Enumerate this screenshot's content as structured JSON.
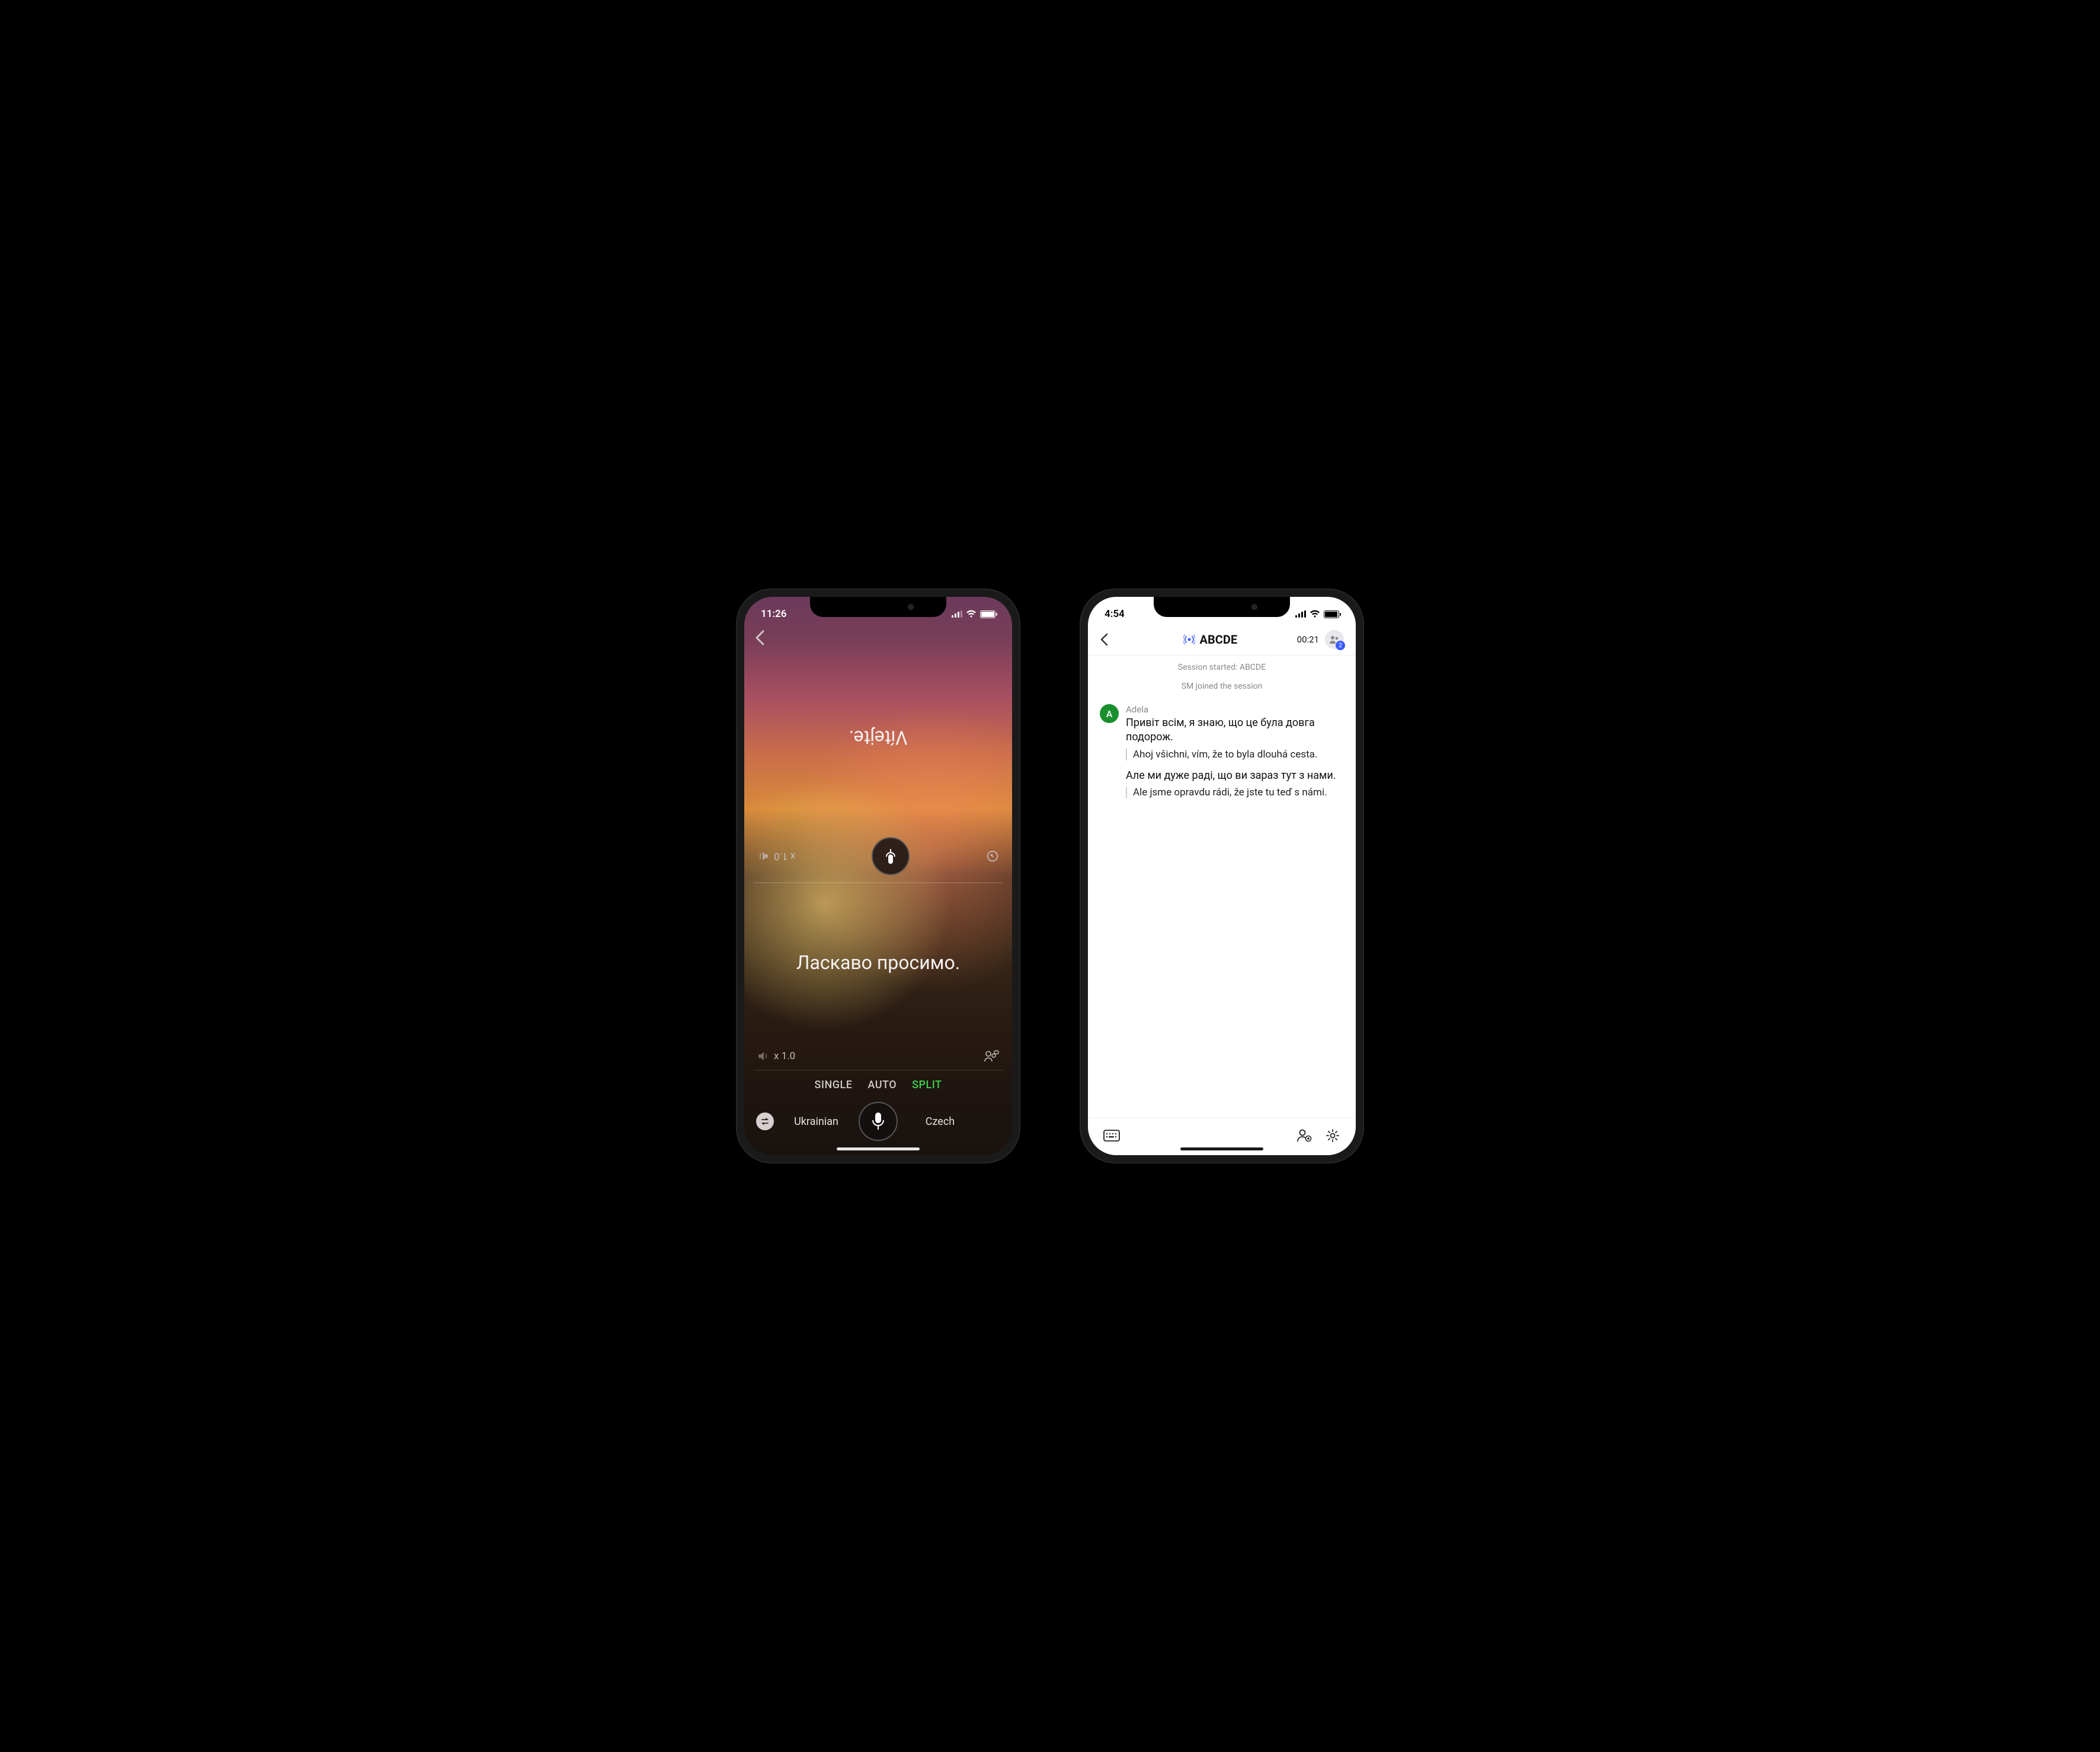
{
  "phone1": {
    "status": {
      "time": "11:26",
      "battery_pct": 95
    },
    "top": {
      "speed": "x 1.0",
      "translation": "Vítejte."
    },
    "bottom": {
      "speed": "x 1.0",
      "translation": "Ласкаво просимо."
    },
    "modes": {
      "single": "SINGLE",
      "auto": "AUTO",
      "split": "SPLIT"
    },
    "lang1": "Ukrainian",
    "lang2": "Czech"
  },
  "phone2": {
    "status": {
      "time": "4:54",
      "battery_pct": 90
    },
    "header": {
      "session_id": "ABCDE",
      "timer": "00:21",
      "participants": "2"
    },
    "meta": {
      "started": "Session started: ABCDE",
      "joined": "SM joined the session"
    },
    "messages": {
      "sender": "Adela",
      "avatar_initial": "A",
      "m1_orig": "Привіт всім, я знаю, що це була довга подорож.",
      "m1_trans": "Ahoj všichni, vím, že to byla dlouhá cesta.",
      "m2_orig": "Але ми дуже раді, що ви зараз тут з нами.",
      "m2_trans": "Ale jsme opravdu rádi, že jste tu teď s námi."
    }
  }
}
